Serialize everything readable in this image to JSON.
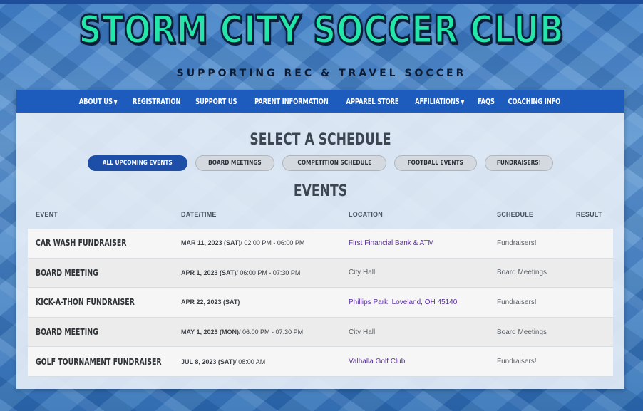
{
  "header": {
    "title": "STORM CITY SOCCER CLUB",
    "subtitle": "SUPPORTING REC & TRAVEL SOCCER"
  },
  "nav": {
    "items": [
      {
        "label": "ABOUT US",
        "has_dropdown": true
      },
      {
        "label": "REGISTRATION",
        "has_dropdown": false
      },
      {
        "label": "SUPPORT US",
        "has_dropdown": false
      },
      {
        "label": "PARENT INFORMATION",
        "has_dropdown": false
      },
      {
        "label": "APPAREL STORE",
        "has_dropdown": false
      },
      {
        "label": "AFFILIATIONS",
        "has_dropdown": true
      },
      {
        "label": "FAQS",
        "has_dropdown": false
      },
      {
        "label": "COACHING INFO",
        "has_dropdown": false
      }
    ],
    "dropdown_glyph": "▼"
  },
  "schedule": {
    "heading": "SELECT A SCHEDULE",
    "filters": [
      {
        "label": "ALL UPCOMING EVENTS",
        "active": true
      },
      {
        "label": "BOARD MEETINGS",
        "active": false
      },
      {
        "label": "COMPETITION SCHEDULE",
        "active": false
      },
      {
        "label": "FOOTBALL EVENTS",
        "active": false
      },
      {
        "label": "FUNDRAISERS!",
        "active": false
      }
    ]
  },
  "events": {
    "heading": "EVENTS",
    "columns": {
      "event": "EVENT",
      "datetime": "DATE/TIME",
      "location": "LOCATION",
      "schedule": "SCHEDULE",
      "result": "RESULT"
    },
    "rows": [
      {
        "event": "CAR WASH FUNDRAISER",
        "date": "MAR 11, 2023 (SAT)",
        "time": " / 02:00 PM - 06:00 PM",
        "location": "First Financial Bank & ATM",
        "location_link": true,
        "schedule": "Fundraisers!",
        "result": ""
      },
      {
        "event": "BOARD MEETING",
        "date": "APR 1, 2023 (SAT)",
        "time": " / 06:00 PM - 07:30 PM",
        "location": "City Hall",
        "location_link": false,
        "schedule": "Board Meetings",
        "result": ""
      },
      {
        "event": "KICK-A-THON FUNDRAISER",
        "date": "APR 22, 2023 (SAT)",
        "time": "",
        "location": "Phillips Park, Loveland, OH 45140",
        "location_link": true,
        "schedule": "Fundraisers!",
        "result": ""
      },
      {
        "event": "BOARD MEETING",
        "date": "MAY 1, 2023 (MON)",
        "time": " / 06:00 PM - 07:30 PM",
        "location": "City Hall",
        "location_link": false,
        "schedule": "Board Meetings",
        "result": ""
      },
      {
        "event": "GOLF TOURNAMENT FUNDRAISER",
        "date": "JUL 8, 2023 (SAT)",
        "time": " / 08:00 AM",
        "location": "Valhalla Golf Club",
        "location_link": true,
        "schedule": "Fundraisers!",
        "result": ""
      }
    ]
  },
  "colors": {
    "nav_bg": "#1d5bbd",
    "logo_green": "#23e7a9",
    "active_pill": "#1d4fa8",
    "link": "#5a2fa0"
  }
}
